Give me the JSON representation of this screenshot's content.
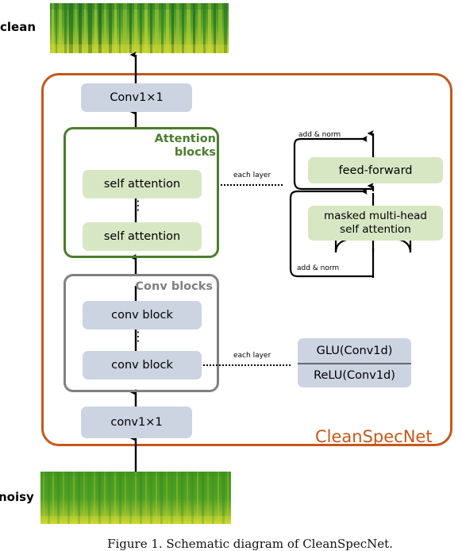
{
  "figure": {
    "caption": "Figure 1. Schematic diagram of CleanSpecNet.",
    "model_name": "CleanSpecNet",
    "accent_color": "#c4591a",
    "attention_color": "#4a7d2c",
    "conv_color": "#808080",
    "blue_box_color": "#ccd4e2",
    "green_box_color": "#d7e7c4"
  },
  "io": {
    "input_label": "noisy",
    "output_label": "clean",
    "input_image_name": "noisy-spectrogram",
    "output_image_name": "clean-spectrogram"
  },
  "main_stack": {
    "output_conv": "Conv1×1",
    "input_conv": "conv1×1",
    "attention_group_label_line1": "Attention",
    "attention_group_label_line2": "blocks",
    "attention_block_top": "self attention",
    "attention_block_bottom": "self attention",
    "conv_group_label": "Conv  blocks",
    "conv_block_top": "conv block",
    "conv_block_bottom": "conv block",
    "ellipsis": "⋮"
  },
  "connectors": {
    "attention_each_layer": "each layer",
    "conv_each_layer": "each layer"
  },
  "attention_detail": {
    "feed_forward": "feed-forward",
    "masked_attention_line1": "masked multi-head",
    "masked_attention_line2": "self attention",
    "add_norm_top": "add & norm",
    "add_norm_bottom": "add & norm"
  },
  "conv_detail": {
    "glu": "GLU(Conv1d)",
    "relu": "ReLU(Conv1d)"
  }
}
